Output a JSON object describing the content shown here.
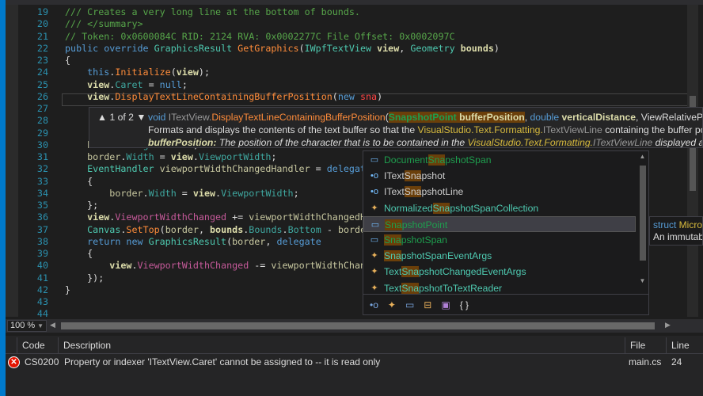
{
  "editor": {
    "lines": [
      {
        "n": "19",
        "t": [
          [
            "/// Creates a very long line at the bottom of bounds.",
            "cm"
          ]
        ]
      },
      {
        "n": "20",
        "t": [
          [
            "/// </summary>",
            "cm"
          ]
        ]
      },
      {
        "n": "21",
        "t": [
          [
            "// Token: 0x0600084C RID: 2124 RVA: 0x0002277C File Offset: 0x0002097C",
            "cm"
          ]
        ]
      },
      {
        "n": "22",
        "t": [
          [
            "public override ",
            "kw"
          ],
          [
            "GraphicsResult ",
            "ty"
          ],
          [
            "GetGraphics",
            "me"
          ],
          [
            "(",
            "tx"
          ],
          [
            "IWpfTextView ",
            "ty"
          ],
          [
            "view",
            "pa"
          ],
          [
            ", ",
            "tx"
          ],
          [
            "Geometry ",
            "ty"
          ],
          [
            "bounds",
            "pa"
          ],
          [
            ")",
            "tx"
          ]
        ]
      },
      {
        "n": "23",
        "t": [
          [
            "{",
            "tx"
          ]
        ]
      },
      {
        "n": "24",
        "t": [
          [
            "    this",
            "kw"
          ],
          [
            ".",
            "tx"
          ],
          [
            "Initialize",
            "me"
          ],
          [
            "(",
            "tx"
          ],
          [
            "view",
            "pa"
          ],
          [
            ");",
            "tx"
          ]
        ]
      },
      {
        "n": "25",
        "t": [
          [
            "    view",
            "pa"
          ],
          [
            ".",
            "tx"
          ],
          [
            "Caret",
            "pr"
          ],
          [
            " = ",
            "tx"
          ],
          [
            "null",
            "kw"
          ],
          [
            ";",
            "tx"
          ]
        ]
      },
      {
        "n": "26",
        "t": [
          [
            "    view",
            "pa"
          ],
          [
            ".",
            "tx"
          ],
          [
            "DisplayTextLineContainingBufferPosition",
            "me"
          ],
          [
            "(",
            "tx"
          ],
          [
            "new ",
            "kw"
          ],
          [
            "sna",
            "er"
          ],
          [
            ")",
            "tx"
          ]
        ]
      },
      {
        "n": "27",
        "t": []
      },
      {
        "n": "28",
        "t": []
      },
      {
        "n": "29",
        "t": []
      },
      {
        "n": "30",
        "t": [
          [
            "    border",
            "lo"
          ],
          [
            ".",
            "tx"
          ],
          [
            "Height",
            "pr"
          ],
          [
            " = 1.0;",
            "tx"
          ]
        ]
      },
      {
        "n": "31",
        "t": [
          [
            "    border",
            "lo"
          ],
          [
            ".",
            "tx"
          ],
          [
            "Width",
            "pr"
          ],
          [
            " = ",
            "tx"
          ],
          [
            "view",
            "pa"
          ],
          [
            ".",
            "tx"
          ],
          [
            "ViewportWidth",
            "pr"
          ],
          [
            ";",
            "tx"
          ]
        ]
      },
      {
        "n": "32",
        "t": [
          [
            "    EventHandler ",
            "ty"
          ],
          [
            "viewportWidthChangedHandler",
            "lo"
          ],
          [
            " = ",
            "tx"
          ],
          [
            "delegate",
            "kw"
          ]
        ]
      },
      {
        "n": "33",
        "t": [
          [
            "    {",
            "tx"
          ]
        ]
      },
      {
        "n": "34",
        "t": [
          [
            "        border",
            "lo"
          ],
          [
            ".",
            "tx"
          ],
          [
            "Width",
            "pr"
          ],
          [
            " = ",
            "tx"
          ],
          [
            "view",
            "pa"
          ],
          [
            ".",
            "tx"
          ],
          [
            "ViewportWidth",
            "pr"
          ],
          [
            ";",
            "tx"
          ]
        ]
      },
      {
        "n": "35",
        "t": [
          [
            "    };",
            "tx"
          ]
        ]
      },
      {
        "n": "36",
        "t": [
          [
            "    view",
            "pa"
          ],
          [
            ".",
            "tx"
          ],
          [
            "ViewportWidthChanged",
            "ev"
          ],
          [
            " += ",
            "tx"
          ],
          [
            "viewportWidthChangedHandler;",
            "lo"
          ]
        ]
      },
      {
        "n": "37",
        "t": [
          [
            "    Canvas",
            "ty"
          ],
          [
            ".",
            "tx"
          ],
          [
            "SetTop",
            "me"
          ],
          [
            "(",
            "tx"
          ],
          [
            "border",
            "lo"
          ],
          [
            ", ",
            "tx"
          ],
          [
            "bounds",
            "pa"
          ],
          [
            ".",
            "tx"
          ],
          [
            "Bounds",
            "pr"
          ],
          [
            ".",
            "tx"
          ],
          [
            "Bottom",
            "pr"
          ],
          [
            " - ",
            "tx"
          ],
          [
            "border",
            "lo"
          ]
        ]
      },
      {
        "n": "38",
        "t": [
          [
            "    return new ",
            "kw"
          ],
          [
            "GraphicsResult",
            "ty"
          ],
          [
            "(",
            "tx"
          ],
          [
            "border",
            "lo"
          ],
          [
            ", ",
            "tx"
          ],
          [
            "delegate",
            "kw"
          ]
        ]
      },
      {
        "n": "39",
        "t": [
          [
            "    {",
            "tx"
          ]
        ]
      },
      {
        "n": "40",
        "t": [
          [
            "        view",
            "pa"
          ],
          [
            ".",
            "tx"
          ],
          [
            "ViewportWidthChanged",
            "ev"
          ],
          [
            " -= ",
            "tx"
          ],
          [
            "viewportWidthChangedHandler;",
            "lo"
          ]
        ]
      },
      {
        "n": "41",
        "t": [
          [
            "    });",
            "tx"
          ]
        ]
      },
      {
        "n": "42",
        "t": [
          [
            "}",
            "tx"
          ]
        ]
      },
      {
        "n": "43",
        "t": []
      },
      {
        "n": "44",
        "t": []
      }
    ]
  },
  "signature": {
    "overload": "▲ 1 of 2 ▼",
    "ret": "void ",
    "iface": "ITextView.",
    "method": "DisplayTextLineContainingBufferPosition",
    "open": "(",
    "p1type": "SnapshotPoint",
    "p1name": " bufferPosition",
    "sep1": ", ",
    "p2type": "double ",
    "p2name": "verticalDistance",
    "sep2": ", ",
    "p3type": "ViewRelativePosition relativeTo)",
    "desc1": "Formats and displays the contents of the text buffer so that the ",
    "desc_ns": "VisualStudio.Text.Formatting.",
    "desc_type": "ITextViewLine",
    "desc2": " containing the buffer position is displayed",
    "param_name": "bufferPosition:",
    "param_desc1": " The position of the character that is to be contained in the ",
    "param_ns": "VisualStudio.Text.Formatting.",
    "param_type": "ITextViewLine",
    "param_desc2": " displayed at the specified position"
  },
  "completion": {
    "items": [
      {
        "pre": "Document",
        "match": "Sna",
        "post": "pshotSpan",
        "icon": "struct-icon",
        "glyph": "▭",
        "kind": "struct"
      },
      {
        "pre": "IText",
        "match": "Sna",
        "post": "pshot",
        "icon": "interface-icon",
        "glyph": "•o",
        "kind": "interface"
      },
      {
        "pre": "IText",
        "match": "Sna",
        "post": "pshotLine",
        "icon": "interface-icon",
        "glyph": "•o",
        "kind": "interface"
      },
      {
        "pre": "Normalized",
        "match": "Sna",
        "post": "pshotSpanCollection",
        "icon": "class-icon",
        "glyph": "✦",
        "kind": "class"
      },
      {
        "pre": "",
        "match": "Sna",
        "post": "pshotPoint",
        "icon": "struct-icon",
        "glyph": "▭",
        "kind": "struct",
        "selected": true
      },
      {
        "pre": "",
        "match": "Sna",
        "post": "pshotSpan",
        "icon": "struct-icon",
        "glyph": "▭",
        "kind": "struct"
      },
      {
        "pre": "",
        "match": "Sna",
        "post": "pshotSpanEventArgs",
        "icon": "class-icon",
        "glyph": "✦",
        "kind": "class"
      },
      {
        "pre": "Text",
        "match": "Sna",
        "post": "pshotChangedEventArgs",
        "icon": "class-icon",
        "glyph": "✦",
        "kind": "class"
      },
      {
        "pre": "Text",
        "match": "Sna",
        "post": "pshotToTextReader",
        "icon": "class-icon",
        "glyph": "✦",
        "kind": "class"
      }
    ],
    "filters": [
      {
        "icon": "interface-filter-icon",
        "glyph": "•o"
      },
      {
        "icon": "class-filter-icon",
        "glyph": "✦"
      },
      {
        "icon": "struct-filter-icon",
        "glyph": "▭"
      },
      {
        "icon": "enum-filter-icon",
        "glyph": "⊟"
      },
      {
        "icon": "module-filter-icon",
        "glyph": "▣"
      },
      {
        "icon": "namespace-filter-icon",
        "glyph": "{ }"
      }
    ]
  },
  "quickinfo": {
    "kw": "struct ",
    "name": "Microsoft.VisualStudio.Text.SnapshotPoint",
    "desc": "An immutable text position"
  },
  "statusbar": {
    "zoom": "100 %"
  },
  "errors": {
    "headers": {
      "code": "Code",
      "description": "Description",
      "file": "File",
      "line": "Line"
    },
    "rows": [
      {
        "code": "CS0200",
        "description": "Property or indexer 'ITextView.Caret' cannot be assigned to -- it is read only",
        "file": "main.cs",
        "line": "24"
      }
    ]
  },
  "colors": {
    "accent": "#007acc",
    "error": "#e51400",
    "match_highlight": "#6b3f0a"
  }
}
